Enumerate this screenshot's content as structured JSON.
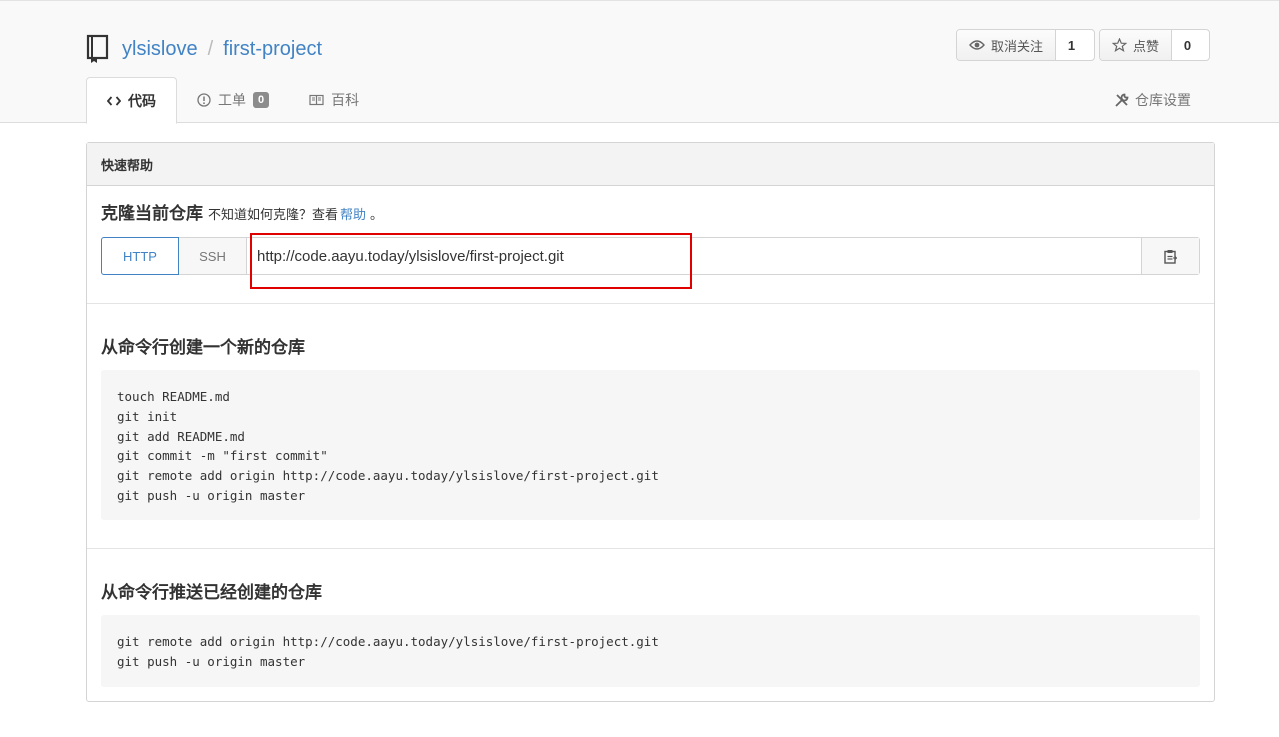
{
  "repo": {
    "owner": "ylsislove",
    "separator": "/",
    "name": "first-project"
  },
  "watch": {
    "label": "取消关注",
    "count": "1",
    "icon": "eye-icon"
  },
  "star": {
    "label": "点赞",
    "count": "0",
    "icon": "star-icon"
  },
  "tabs": [
    {
      "label": "代码",
      "icon": "code-icon",
      "active": true
    },
    {
      "label": "工单",
      "icon": "issue-icon",
      "badge": "0"
    },
    {
      "label": "百科",
      "icon": "book-open-icon"
    }
  ],
  "settings": {
    "label": "仓库设置",
    "icon": "tools-icon"
  },
  "quick_help": {
    "title": "快速帮助",
    "clone_title": "克隆当前仓库",
    "clone_hint": "不知道如何克隆？查看",
    "help_link": "帮助",
    "hint_end": "。",
    "protocols": [
      "HTTP",
      "SSH"
    ],
    "clone_url": "http://code.aayu.today/ylsislove/first-project.git"
  },
  "sections": [
    {
      "title": "从命令行创建一个新的仓库",
      "code": "touch README.md\ngit init\ngit add README.md\ngit commit -m \"first commit\"\ngit remote add origin http://code.aayu.today/ylsislove/first-project.git\ngit push -u origin master"
    },
    {
      "title": "从命令行推送已经创建的仓库",
      "code": "git remote add origin http://code.aayu.today/ylsislove/first-project.git\ngit push -u origin master"
    }
  ],
  "colors": {
    "link": "#4183c4",
    "highlight": "#e00000",
    "badge": "#8c8c8c"
  }
}
